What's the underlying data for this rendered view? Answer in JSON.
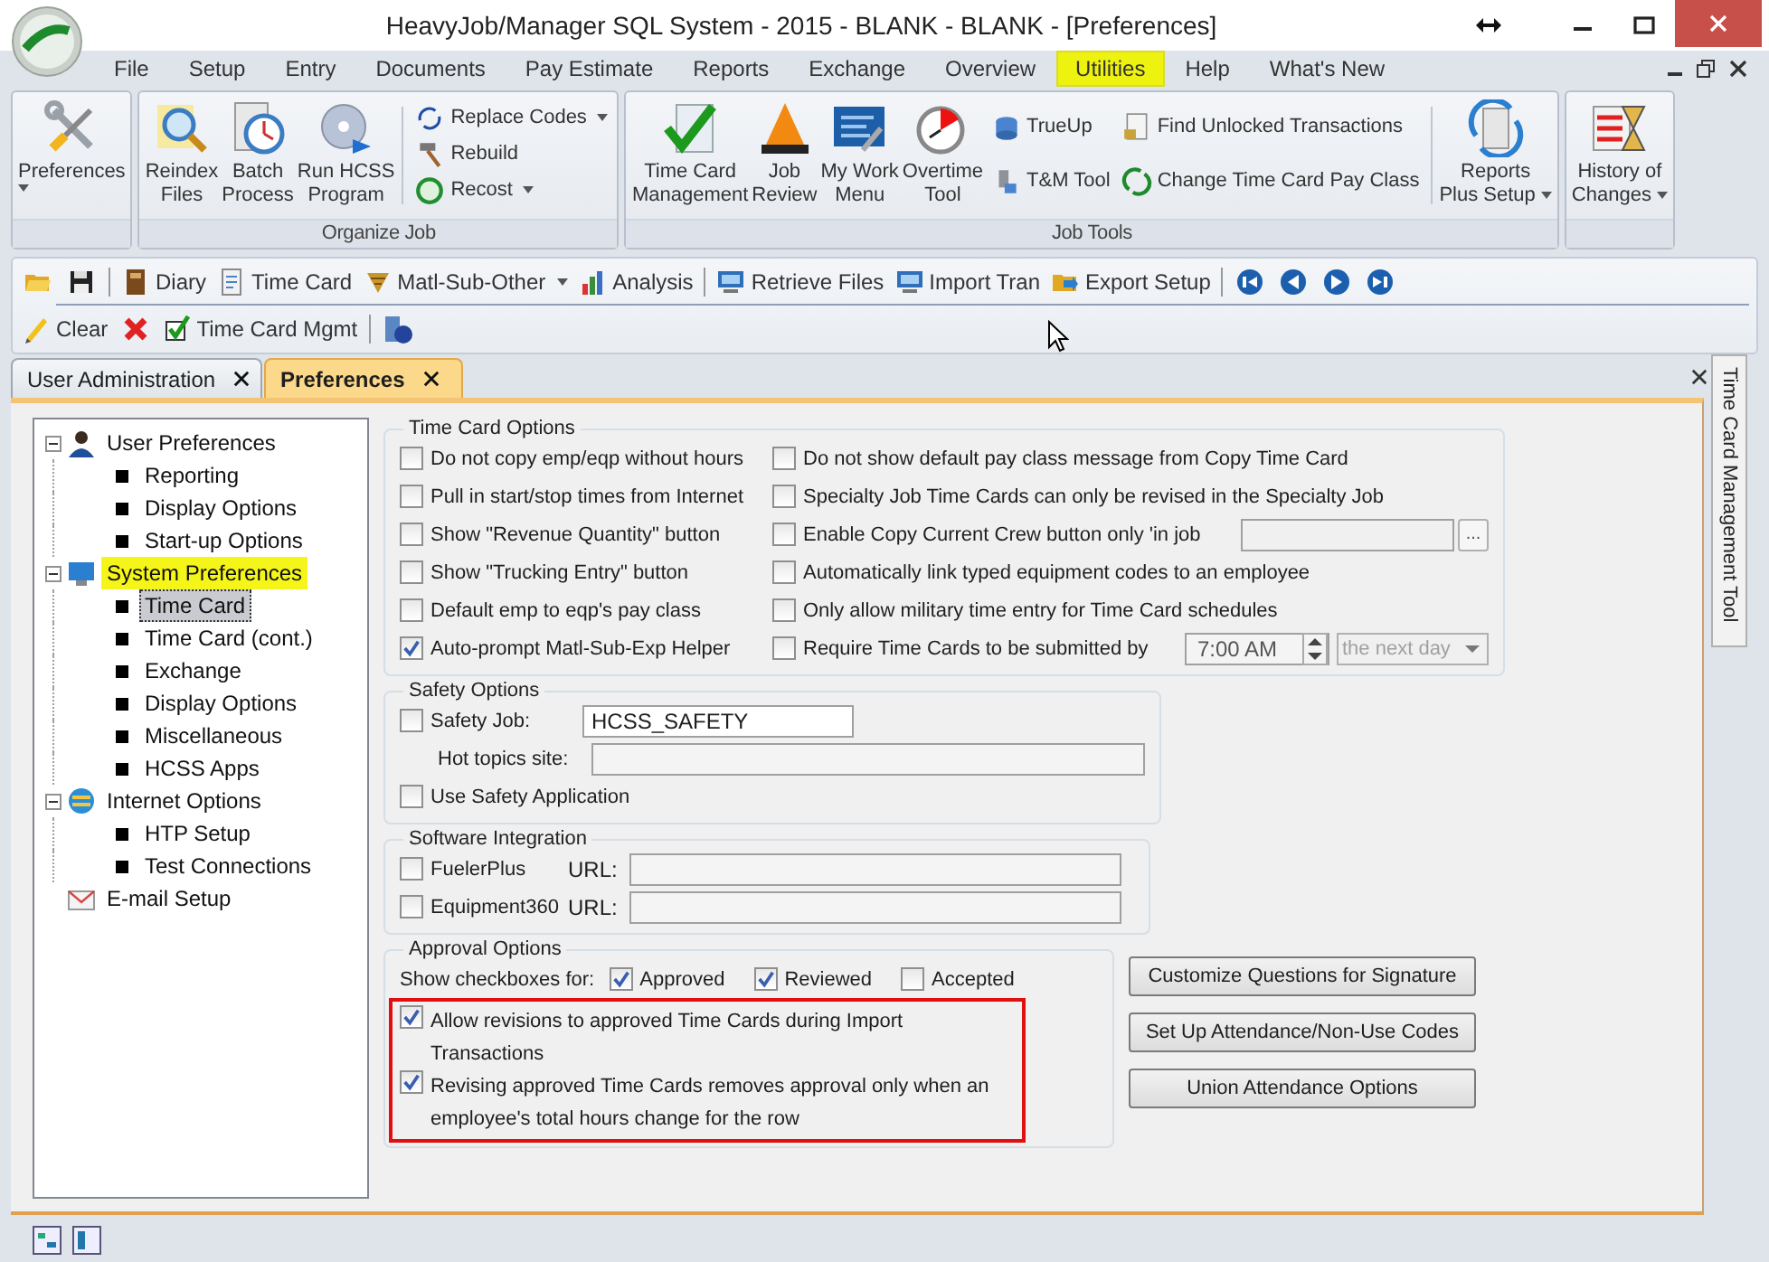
{
  "window": {
    "title": "HeavyJob/Manager SQL System - 2015 - BLANK - BLANK - [Preferences]"
  },
  "menu": [
    {
      "label": "File",
      "selected": false
    },
    {
      "label": "Setup",
      "selected": false
    },
    {
      "label": "Entry",
      "selected": false
    },
    {
      "label": "Documents",
      "selected": false
    },
    {
      "label": "Pay Estimate",
      "selected": false
    },
    {
      "label": "Reports",
      "selected": false
    },
    {
      "label": "Exchange",
      "selected": false
    },
    {
      "label": "Overview",
      "selected": false
    },
    {
      "label": "Utilities",
      "selected": true
    },
    {
      "label": "Help",
      "selected": false
    },
    {
      "label": "What's New",
      "selected": false
    }
  ],
  "ribbon": [
    {
      "items": [
        {
          "kind": "large",
          "label": "Preferences",
          "dropdown": true
        }
      ]
    },
    {
      "label": "Organize Job",
      "items": [
        {
          "kind": "large",
          "label": "Reindex\nFiles",
          "dropdown": false
        },
        {
          "kind": "large",
          "label": "Batch\nProcess",
          "dropdown": false
        },
        {
          "kind": "large",
          "label": "Run HCSS\nProgram",
          "dropdown": false
        },
        {
          "kind": "separator"
        },
        {
          "kind": "column",
          "items": [
            {
              "label": "Replace Codes",
              "dropdown": true
            },
            {
              "label": "Rebuild",
              "dropdown": false
            },
            {
              "label": "Recost",
              "dropdown": true
            }
          ]
        }
      ]
    },
    {
      "label": "Job Tools",
      "items": [
        {
          "kind": "large",
          "label": "Time Card\nManagement",
          "dropdown": false
        },
        {
          "kind": "large",
          "label": "Job\nReview",
          "dropdown": false
        },
        {
          "kind": "large",
          "label": "My Work\nMenu",
          "dropdown": false
        },
        {
          "kind": "large",
          "label": "Overtime\nTool",
          "dropdown": false
        },
        {
          "kind": "column",
          "items": [
            {
              "label": "TrueUp",
              "dropdown": false
            },
            {
              "label": "T&M Tool",
              "dropdown": false
            }
          ]
        },
        {
          "kind": "column",
          "items": [
            {
              "label": "Find Unlocked Transactions",
              "dropdown": false
            },
            {
              "label": "Change Time Card Pay Class",
              "dropdown": false
            }
          ]
        },
        {
          "kind": "separator"
        },
        {
          "kind": "large",
          "label": "Reports\nPlus Setup",
          "dropdown": true
        }
      ]
    },
    {
      "items": [
        {
          "kind": "large",
          "label": "History of\nChanges",
          "dropdown": true
        }
      ]
    }
  ],
  "toolbar": [
    [
      {
        "kind": "icon"
      },
      {
        "kind": "icon"
      },
      {
        "kind": "separator"
      },
      {
        "kind": "button",
        "label": "Diary",
        "dropdown": false
      },
      {
        "kind": "button",
        "label": "Time Card",
        "dropdown": false
      },
      {
        "kind": "button",
        "label": "Matl-Sub-Other",
        "dropdown": true
      },
      {
        "kind": "button",
        "label": "Analysis",
        "dropdown": false
      },
      {
        "kind": "separator"
      },
      {
        "kind": "button",
        "label": "Retrieve Files",
        "dropdown": false
      },
      {
        "kind": "button",
        "label": "Import Tran",
        "dropdown": false
      },
      {
        "kind": "button",
        "label": "Export Setup",
        "dropdown": false
      },
      {
        "kind": "separator"
      },
      {
        "kind": "icon"
      },
      {
        "kind": "icon"
      },
      {
        "kind": "icon"
      },
      {
        "kind": "icon"
      }
    ],
    [
      {
        "kind": "button",
        "label": "Clear",
        "dropdown": false
      },
      {
        "kind": "icon"
      },
      {
        "kind": "button",
        "label": "Time Card Mgmt",
        "dropdown": false
      },
      {
        "kind": "separator"
      },
      {
        "kind": "icon"
      }
    ]
  ],
  "tabs": [
    {
      "label": "User Administration",
      "selected": false
    },
    {
      "label": "Preferences",
      "selected": true
    }
  ],
  "tree": [
    {
      "label": "User Preferences",
      "expanded": true,
      "selected": false,
      "highlighted": false,
      "children": [
        {
          "label": "Reporting",
          "selected": false
        },
        {
          "label": "Display Options",
          "selected": false
        },
        {
          "label": "Start-up Options",
          "selected": false
        }
      ]
    },
    {
      "label": "System Preferences",
      "expanded": true,
      "selected": false,
      "highlighted": true,
      "children": [
        {
          "label": "Time Card",
          "selected": true
        },
        {
          "label": "Time Card (cont.)",
          "selected": false
        },
        {
          "label": "Exchange",
          "selected": false
        },
        {
          "label": "Display Options",
          "selected": false
        },
        {
          "label": "Miscellaneous",
          "selected": false
        },
        {
          "label": "HCSS Apps",
          "selected": false
        }
      ]
    },
    {
      "label": "Internet Options",
      "expanded": true,
      "selected": false,
      "highlighted": false,
      "children": [
        {
          "label": "HTP Setup",
          "selected": false
        },
        {
          "label": "Test Connections",
          "selected": false
        }
      ]
    },
    {
      "label": "E-mail Setup",
      "selected": false,
      "highlighted": false
    }
  ],
  "time_card_options": {
    "title": "Time Card Options",
    "left": [
      {
        "label": "Do not copy emp/eqp without hours",
        "checked": false
      },
      {
        "label": "Pull in start/stop times from Internet",
        "checked": false
      },
      {
        "label": "Show \"Revenue Quantity\" button",
        "checked": false
      },
      {
        "label": "Show \"Trucking Entry\" button",
        "checked": false
      },
      {
        "label": "Default emp to eqp's pay class",
        "checked": false
      },
      {
        "label": "Auto-prompt Matl-Sub-Exp Helper",
        "checked": true
      }
    ],
    "right": [
      {
        "kind": "plain",
        "label": "Do not show default pay class message from Copy Time Card",
        "checked": false
      },
      {
        "kind": "plain",
        "label": "Specialty Job Time Cards can only be revised in the Specialty Job",
        "checked": false
      },
      {
        "kind": "browse",
        "label": "Enable Copy Current Crew button only 'in job",
        "checked": false,
        "button": "..."
      },
      {
        "kind": "plain",
        "label": "Automatically link typed equipment codes to an employee",
        "checked": false
      },
      {
        "kind": "plain",
        "label": "Only allow military time entry for Time Card schedules",
        "checked": false
      },
      {
        "kind": "deadline",
        "label": "Require Time Cards to be submitted by",
        "checked": false,
        "time": "7:00 AM",
        "day": {
          "value": "the next day",
          "disabled": true
        }
      }
    ]
  },
  "safety_options": {
    "title": "Safety Options",
    "job": {
      "label": "Safety Job:",
      "checked": false,
      "value": "HCSS_SAFETY"
    },
    "hot_topics": {
      "label": "Hot topics site:"
    },
    "use_app": {
      "label": "Use Safety Application",
      "checked": false
    }
  },
  "software_integration": {
    "title": "Software Integration",
    "items": [
      {
        "label": "FuelerPlus",
        "checked": false,
        "url_label": "URL:"
      },
      {
        "label": "Equipment360",
        "checked": false,
        "url_label": "URL:"
      }
    ]
  },
  "approval_options": {
    "title": "Approval Options",
    "show_label": "Show checkboxes for:",
    "show": [
      {
        "label": "Approved",
        "checked": true
      },
      {
        "label": "Reviewed",
        "checked": true
      },
      {
        "label": "Accepted",
        "checked": false
      }
    ],
    "outlined": true,
    "revisions": [
      {
        "label": "Allow revisions to approved Time Cards during Import Transactions",
        "checked": true
      },
      {
        "label": "Revising approved Time Cards removes approval only when an employee's total hours change for the row",
        "checked": true
      }
    ]
  },
  "buttons": [
    "Customize Questions for Signature",
    "Set Up Attendance/Non-Use Codes",
    "Union Attendance Options"
  ],
  "side_tab": {
    "label": "Time Card Management Tool"
  }
}
